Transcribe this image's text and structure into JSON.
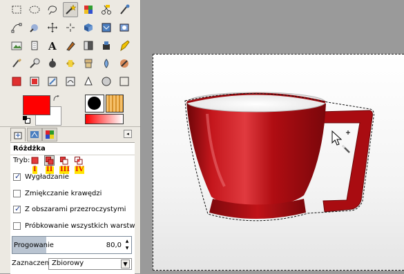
{
  "toolbox": {
    "tools": [
      "rect-select-icon",
      "ellipse-select-icon",
      "free-select-icon",
      "fuzzy-select-icon",
      "select-by-color-icon",
      "scissors-select-icon",
      "foreground-select-icon",
      "paths-icon",
      "color-picker-icon",
      "zoom-icon",
      "measure-icon",
      "move-icon",
      "align-icon",
      "crop-icon",
      "rotate-icon",
      "scale-icon",
      "shear-icon",
      "perspective-icon",
      "flip-icon",
      "cage-icon",
      "text-icon",
      "bucket-fill-icon",
      "blend-icon",
      "pencil-icon",
      "paintbrush-icon",
      "eraser-icon",
      "airbrush-icon",
      "ink-icon",
      "clone-icon",
      "heal-icon",
      "perspective-clone-icon",
      "blur-icon",
      "smudge-icon",
      "dodge-burn-icon",
      "unified-transform-icon",
      "handle-transform-icon",
      "warp-icon"
    ],
    "active_tool": "fuzzy-select-icon",
    "colors": {
      "foreground": "#ff0000",
      "background": "#ffffff"
    }
  },
  "tool_options": {
    "title": "Różdżka",
    "mode_label": "Tryb:",
    "mode_numerals": [
      "I",
      "II",
      "III",
      "IV"
    ],
    "active_mode": 1,
    "options": [
      {
        "label": "Wygładzanie",
        "checked": true
      },
      {
        "label": "Zmiękczanie krawędzi",
        "checked": false
      },
      {
        "label": "Z obszarami przezroczystymi",
        "checked": true
      },
      {
        "label": "Próbkowanie wszystkich warstw",
        "checked": false
      }
    ],
    "threshold": {
      "label": "Progowanie",
      "value": "80,0"
    },
    "selection_mode": {
      "label": "Zaznaczenie:",
      "value": "Zbiorowy"
    }
  },
  "canvas": {
    "object": "cup",
    "colors": {
      "cup": "#b00d12",
      "cup_dark": "#6c0508",
      "cup_highlight": "#e03a3f",
      "cup_interior": "#f1f1f1"
    }
  }
}
